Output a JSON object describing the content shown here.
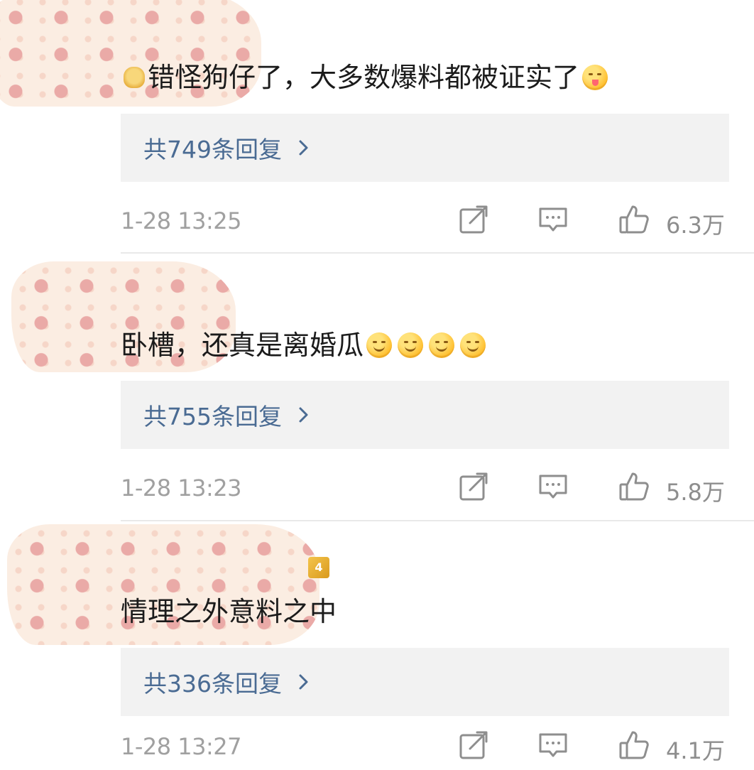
{
  "comments": [
    {
      "text": "错怪狗仔了，大多数爆料都被证实了",
      "leading_emoji": "doge-emoji",
      "trailing_emojis": [
        "yum-emoji"
      ],
      "replies_label": "共749条回复",
      "timestamp": "1-28 13:25",
      "likes": "6.3万"
    },
    {
      "text": "卧槽，还真是离婚瓜",
      "trailing_emojis": [
        "smile-emoji",
        "smile-emoji",
        "smile-emoji",
        "smile-emoji"
      ],
      "replies_label": "共755条回复",
      "timestamp": "1-28 13:23",
      "likes": "5.8万"
    },
    {
      "text": "情理之外意料之中",
      "badge": "4",
      "replies_label": "共336条回复",
      "timestamp": "1-28 13:27",
      "likes": "4.1万"
    }
  ],
  "icons": {
    "share": "share-icon",
    "comment": "comment-icon",
    "like": "thumbs-up-icon",
    "chevron": "chevron-right-icon"
  },
  "colors": {
    "reply_link": "#4a6b93",
    "reply_bg": "#f2f2f2",
    "meta_text": "#a0a0a0",
    "sticker_bg": "#fbece0",
    "sticker_pattern": "#e9a3a0"
  }
}
